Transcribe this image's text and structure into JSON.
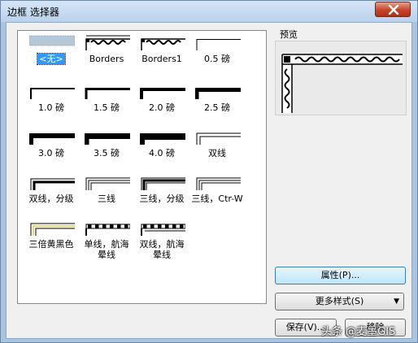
{
  "window": {
    "title": "边框 选择器",
    "close_label": "✕"
  },
  "border_list": {
    "items": [
      {
        "label": "<无>",
        "style": "none",
        "selected": true
      },
      {
        "label": "Borders",
        "style": "art1"
      },
      {
        "label": "Borders1",
        "style": "art2"
      },
      {
        "label": "0.5 磅",
        "style": "line",
        "weight": 0.5
      },
      {
        "label": "1.0 磅",
        "style": "line",
        "weight": 1.0
      },
      {
        "label": "1.5 磅",
        "style": "line",
        "weight": 1.5
      },
      {
        "label": "2.0 磅",
        "style": "line",
        "weight": 2.0
      },
      {
        "label": "2.5 磅",
        "style": "line",
        "weight": 2.5
      },
      {
        "label": "3.0 磅",
        "style": "line",
        "weight": 3.0
      },
      {
        "label": "3.5 磅",
        "style": "line",
        "weight": 3.5
      },
      {
        "label": "4.0 磅",
        "style": "line",
        "weight": 4.0
      },
      {
        "label": "双线",
        "style": "double"
      },
      {
        "label": "双线，分级",
        "style": "double-graded"
      },
      {
        "label": "三线",
        "style": "triple"
      },
      {
        "label": "三线，分级",
        "style": "triple-graded"
      },
      {
        "label": "三线，Ctr-W",
        "style": "triple-ctrw"
      },
      {
        "label": "三倍黄黑色",
        "style": "triple-yellow"
      },
      {
        "label": "单线，航海\n晕线",
        "style": "nautical-single"
      },
      {
        "label": "双线，航海\n晕线",
        "style": "nautical-double"
      }
    ]
  },
  "preview": {
    "caption": "预览"
  },
  "buttons": {
    "properties": "属性(P)...",
    "more_styles": "更多样式(S)",
    "save": "保存(V)...",
    "other": "移除"
  },
  "watermark": "头条 @麦墨GIS"
}
